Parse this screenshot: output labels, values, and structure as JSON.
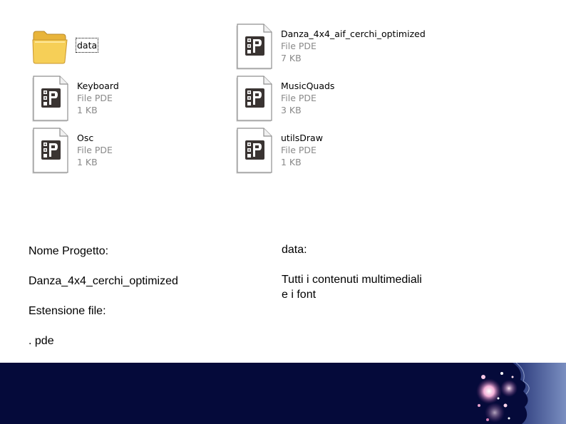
{
  "explorer": {
    "items": [
      {
        "name": "data",
        "type": "",
        "size": ""
      },
      {
        "name": "Danza_4x4_aif_cerchi_optimized",
        "type": "File PDE",
        "size": "7 KB"
      },
      {
        "name": "Keyboard",
        "type": "File PDE",
        "size": "1 KB"
      },
      {
        "name": "MusicQuads",
        "type": "File PDE",
        "size": "3 KB"
      },
      {
        "name": "Osc",
        "type": "File PDE",
        "size": "1 KB"
      },
      {
        "name": "utilsDraw",
        "type": "File PDE",
        "size": "1 KB"
      }
    ]
  },
  "slide": {
    "project_label": "Nome Progetto:",
    "project_value": "Danza_4x4_cerchi_optimized",
    "ext_label": "Estensione file:",
    "ext_value": ". pde",
    "data_label": "data:",
    "data_desc_line1": "Tutti i contenuti multimediali",
    "data_desc_line2": "e i font"
  },
  "colors": {
    "footer_bg": "#050a3a",
    "meta_text": "#8a8a8a",
    "folder": "#f3c64a"
  },
  "icons": {
    "folder": "folder-icon",
    "pde": "processing-file-icon"
  }
}
